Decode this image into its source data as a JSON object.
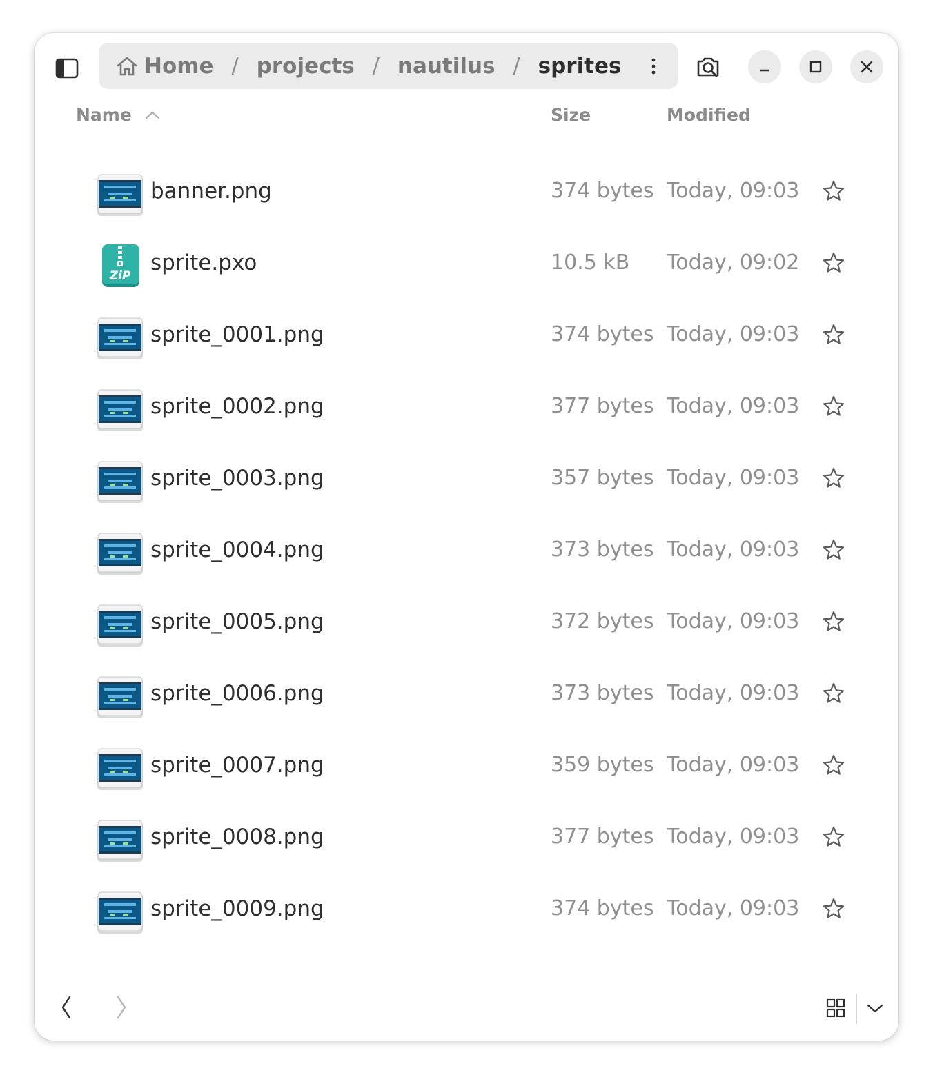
{
  "pathbar": {
    "crumbs": [
      "Home",
      "projects",
      "nautilus",
      "sprites"
    ],
    "separator": "/"
  },
  "icons": {
    "sidebar_toggle": "sidebar-toggle-icon",
    "home": "home-icon",
    "path_menu": "kebab-menu-icon",
    "search": "search-icon",
    "minimize": "minimize-icon",
    "maximize": "maximize-icon",
    "close": "close-icon",
    "star": "star-icon",
    "back": "back-chevron-icon",
    "forward": "forward-chevron-icon",
    "grid_view": "grid-view-icon",
    "view_options": "chevron-down-icon"
  },
  "columns": {
    "name": "Name",
    "size": "Size",
    "modified": "Modified",
    "sort": "ascending"
  },
  "files": [
    {
      "name": "banner.png",
      "size": "374 bytes",
      "modified": "Today, 09:03",
      "type": "image"
    },
    {
      "name": "sprite.pxo",
      "size": "10.5 kB",
      "modified": "Today, 09:02",
      "type": "zip"
    },
    {
      "name": "sprite_0001.png",
      "size": "374 bytes",
      "modified": "Today, 09:03",
      "type": "image"
    },
    {
      "name": "sprite_0002.png",
      "size": "377 bytes",
      "modified": "Today, 09:03",
      "type": "image"
    },
    {
      "name": "sprite_0003.png",
      "size": "357 bytes",
      "modified": "Today, 09:03",
      "type": "image"
    },
    {
      "name": "sprite_0004.png",
      "size": "373 bytes",
      "modified": "Today, 09:03",
      "type": "image"
    },
    {
      "name": "sprite_0005.png",
      "size": "372 bytes",
      "modified": "Today, 09:03",
      "type": "image"
    },
    {
      "name": "sprite_0006.png",
      "size": "373 bytes",
      "modified": "Today, 09:03",
      "type": "image"
    },
    {
      "name": "sprite_0007.png",
      "size": "359 bytes",
      "modified": "Today, 09:03",
      "type": "image"
    },
    {
      "name": "sprite_0008.png",
      "size": "377 bytes",
      "modified": "Today, 09:03",
      "type": "image"
    },
    {
      "name": "sprite_0009.png",
      "size": "374 bytes",
      "modified": "Today, 09:03",
      "type": "image"
    }
  ],
  "colors": {
    "window_bg": "#ffffff",
    "pathbar_bg": "#ebebeb",
    "text_primary": "#2e2e2e",
    "text_secondary": "#8f8f8f",
    "zip_icon": "#2aa198",
    "image_icon": "#1f5f8b"
  }
}
